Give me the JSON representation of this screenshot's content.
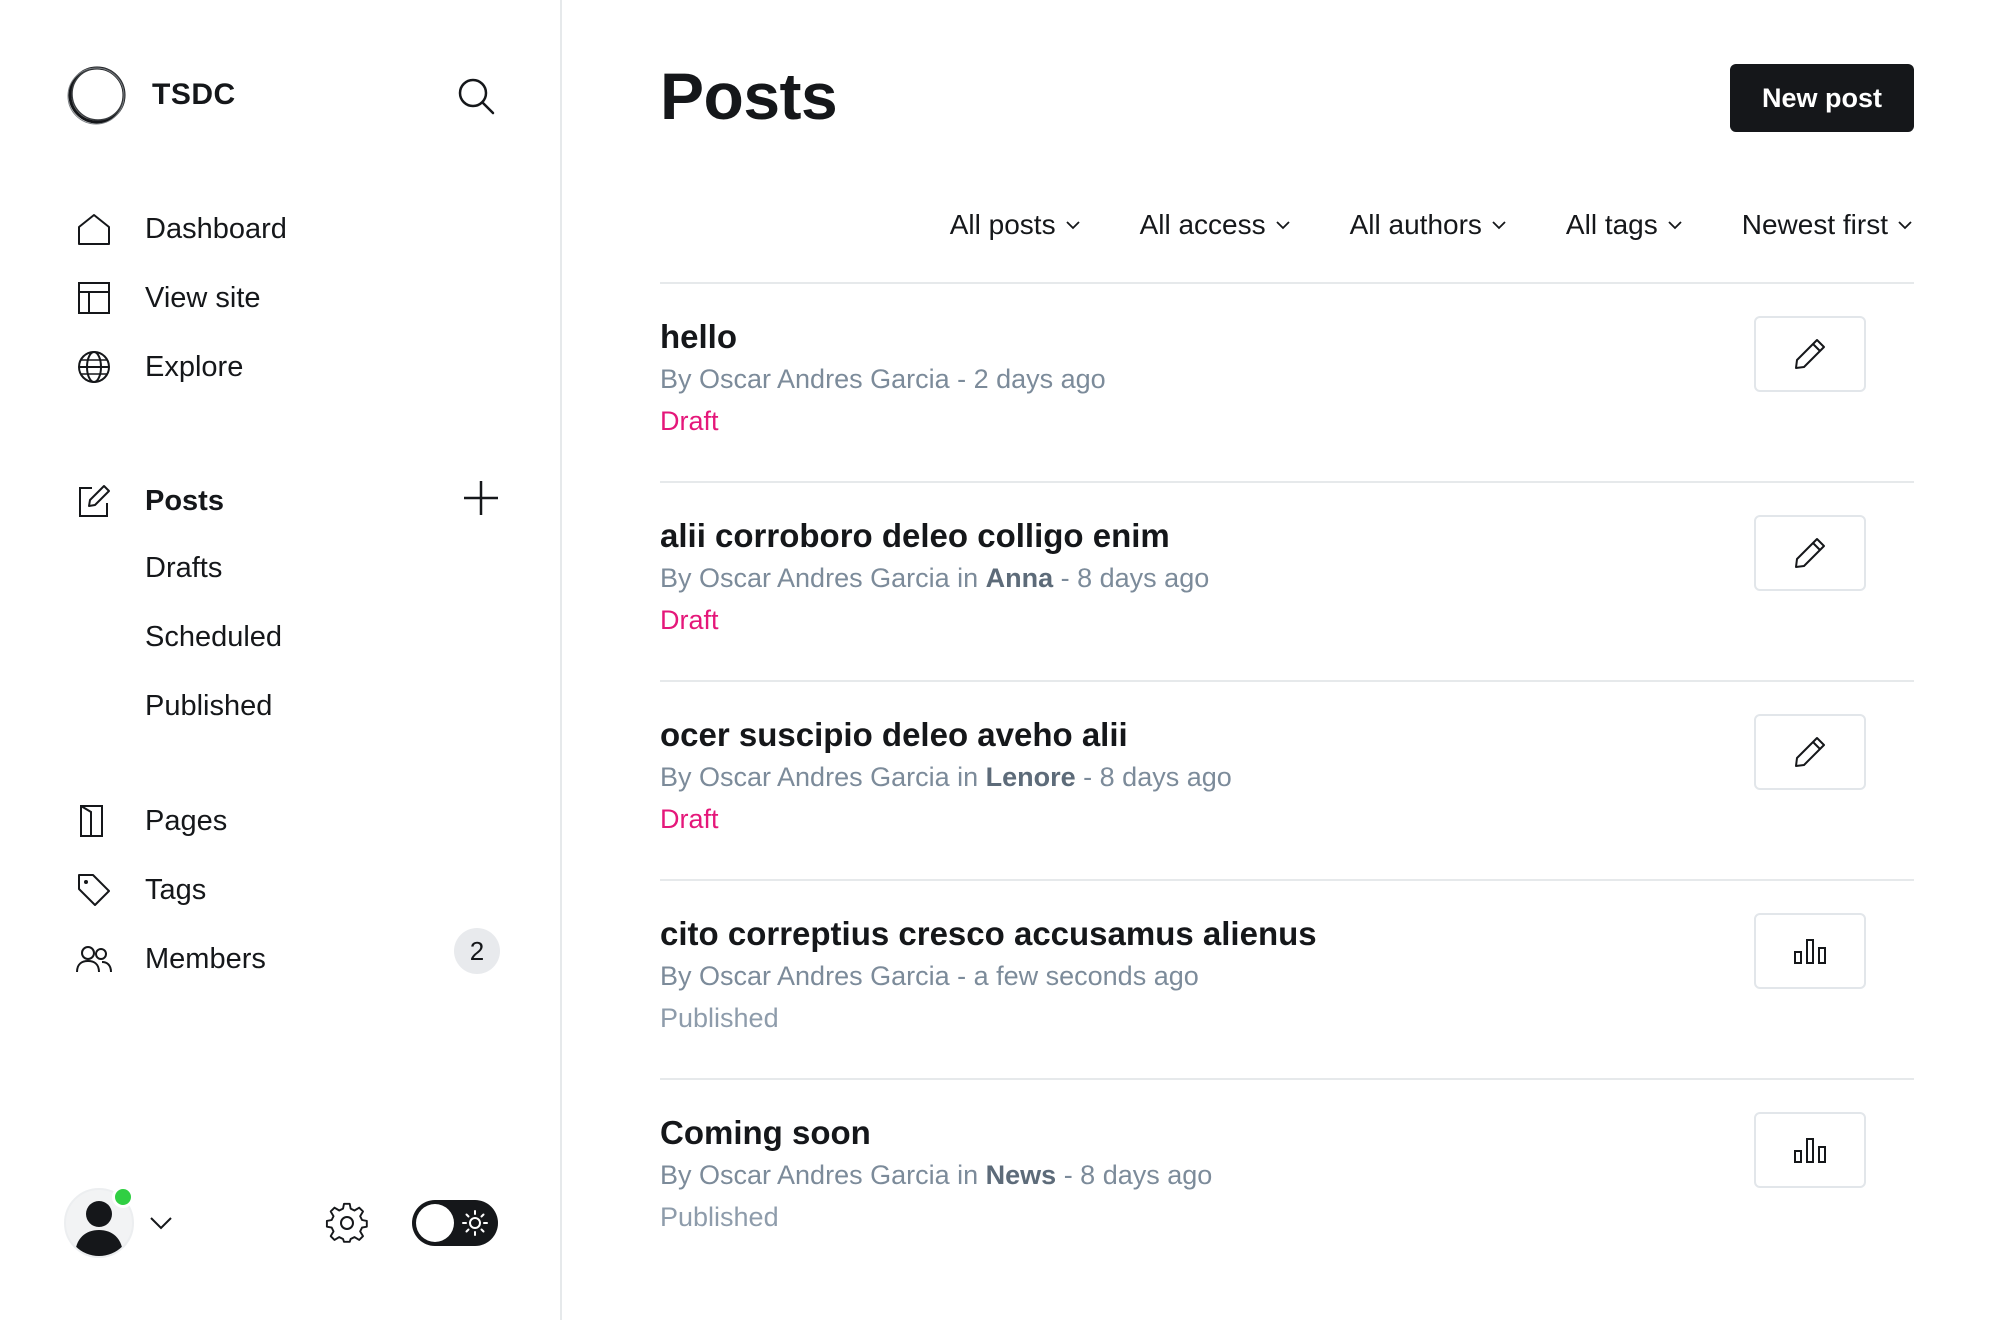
{
  "brand": {
    "name": "TSDC"
  },
  "nav": {
    "dashboard": "Dashboard",
    "view_site": "View site",
    "explore": "Explore",
    "posts": "Posts",
    "drafts": "Drafts",
    "scheduled": "Scheduled",
    "published": "Published",
    "pages": "Pages",
    "tags": "Tags",
    "members": "Members",
    "members_count": "2"
  },
  "header": {
    "title": "Posts",
    "new_post_label": "New post"
  },
  "filters": [
    "All posts",
    "All access",
    "All authors",
    "All tags",
    "Newest first"
  ],
  "posts": [
    {
      "title": "hello",
      "by": "By Oscar Andres Garcia",
      "in": "",
      "tag": "",
      "time": " - 2 days ago",
      "status": "Draft",
      "action_icon": "pencil-icon"
    },
    {
      "title": "alii corroboro deleo colligo enim",
      "by": "By Oscar Andres Garcia",
      "in": " in ",
      "tag": "Anna",
      "time": " - 8 days ago",
      "status": "Draft",
      "action_icon": "pencil-icon"
    },
    {
      "title": "ocer suscipio deleo aveho alii",
      "by": "By Oscar Andres Garcia",
      "in": " in ",
      "tag": "Lenore",
      "time": " - 8 days ago",
      "status": "Draft",
      "action_icon": "pencil-icon"
    },
    {
      "title": "cito correptius cresco accusamus alienus",
      "by": "By Oscar Andres Garcia",
      "in": "",
      "tag": "",
      "time": " - a few seconds ago",
      "status": "Published",
      "action_icon": "bar-chart-icon"
    },
    {
      "title": "Coming soon",
      "by": "By Oscar Andres Garcia",
      "in": " in ",
      "tag": "News",
      "time": " - 8 days ago",
      "status": "Published",
      "action_icon": "bar-chart-icon"
    }
  ],
  "colors": {
    "draft": "#e5177a",
    "published": "#8e9cab",
    "online": "#30cf43",
    "primary": "#15171a"
  }
}
